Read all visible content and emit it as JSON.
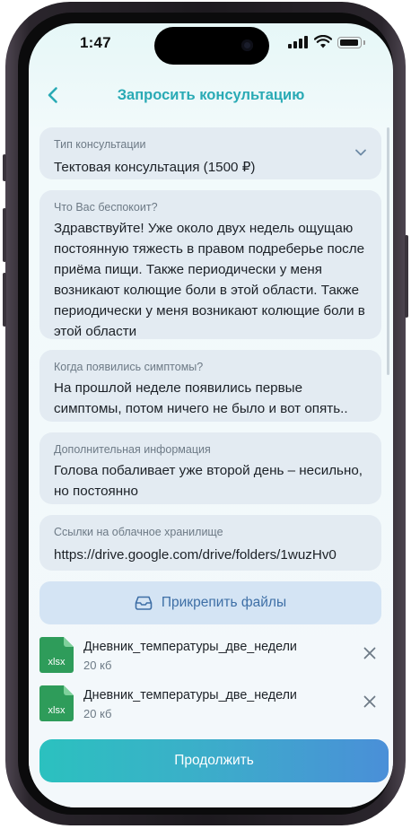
{
  "status_bar": {
    "time": "1:47"
  },
  "header": {
    "title": "Запросить консультацию"
  },
  "form": {
    "consult_type": {
      "label": "Тип консультации",
      "value": "Тектовая консультация (1500 ₽)"
    },
    "concern": {
      "label": "Что Вас беспокоит?",
      "value": "Здравствуйте! Уже около двух недель ощущаю постоянную тяжесть в правом подреберье после приёма пищи. Также периодически у меня возникают колющие боли в этой области. Также периодически у меня возникают колющие боли в этой области"
    },
    "symptoms_start": {
      "label": "Когда появились симптомы?",
      "value": "На прошлой неделе появились первые симптомы, потом ничего не было и вот опять.."
    },
    "additional_info": {
      "label": "Дополнительная информация",
      "value": "Голова побаливает уже второй день – несильно, но постоянно"
    },
    "cloud_links": {
      "label": "Ссылки на облачное хранилище",
      "value": "https://drive.google.com/drive/folders/1wuzHv0"
    }
  },
  "attach_button": {
    "label": "Прикрепить файлы",
    "icon": "inbox-tray-icon"
  },
  "files": [
    {
      "name": "Дневник_температуры_две_недели",
      "size": "20 кб",
      "ext": "xlsx",
      "icon": "excel-file-icon"
    },
    {
      "name": "Дневник_температуры_две_недели",
      "size": "20 кб",
      "ext": "xlsx",
      "icon": "excel-file-icon"
    }
  ],
  "continue_button": {
    "label": "Продолжить"
  },
  "colors": {
    "accent": "#29aab5",
    "field_bg": "#e3ebf2",
    "attach_bg": "#d4e4f4",
    "file_green": "#2e9c5a"
  }
}
